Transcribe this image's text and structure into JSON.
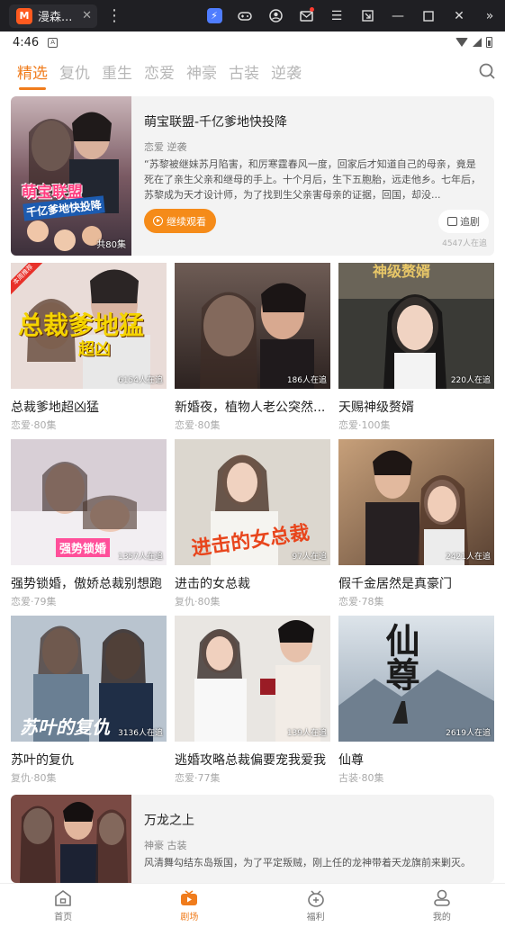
{
  "emulator": {
    "tab_title": "漫森...",
    "app_icon_glyph": "M",
    "icons": [
      "bolt-icon",
      "gamepad-icon",
      "account-icon",
      "mail-icon",
      "menu-icon",
      "screenshot-icon",
      "minimize-icon",
      "maximize-icon",
      "close-icon",
      "collapse-icon"
    ]
  },
  "status_bar": {
    "time": "4:46",
    "notif_glyph": "A"
  },
  "tabs": [
    "精选",
    "复仇",
    "重生",
    "恋爱",
    "神豪",
    "古装",
    "逆袭"
  ],
  "featured": {
    "title": "萌宝联盟-千亿爹地快投降",
    "tags": "恋爱 逆袭",
    "desc": "“苏黎被继妹苏月陷害，和厉寒霆春风一度，回家后才知道自己的母亲，竟是死在了亲生父亲和继母的手上。十个月后，生下五胞胎，远走他乡。七年后，苏黎成为天才设计师，为了找到生父亲害母亲的证据，回国，却没...",
    "continue_label": "继续观看",
    "follow_label": "追剧",
    "watching": "4547人在追",
    "poster_title_line1": "萌宝联盟",
    "poster_title_line2": "千亿爹地快投降",
    "episodes_badge": "共80集"
  },
  "grid": [
    {
      "name": "总裁爹地超凶猛",
      "meta": "恋爱·80集",
      "watching": "6154人在追",
      "cover_text": "总裁爹地猛",
      "cover_text2": "超凶",
      "ribbon": "本周推荐"
    },
    {
      "name": "新婚夜，植物人老公突然...",
      "meta": "恋爱·80集",
      "watching": "186人在追"
    },
    {
      "name": "天赐神级赘婿",
      "meta": "恋爱·100集",
      "watching": "220人在追",
      "cover_text": "神级赘婿"
    },
    {
      "name": "强势锁婚，傲娇总裁别想跑",
      "meta": "恋爱·79集",
      "watching": "1357人在追",
      "cover_text": "强势锁婚"
    },
    {
      "name": "进击的女总裁",
      "meta": "复仇·80集",
      "watching": "97人在追",
      "cover_text": "进击的女总裁"
    },
    {
      "name": "假千金居然是真豪门",
      "meta": "恋爱·78集",
      "watching": "2421人在追"
    },
    {
      "name": "苏叶的复仇",
      "meta": "复仇·80集",
      "watching": "3136人在追",
      "cover_text": "苏叶的复仇"
    },
    {
      "name": "逃婚攻略总裁偏要宠我爱我",
      "meta": "恋爱·77集",
      "watching": "139人在追"
    },
    {
      "name": "仙尊",
      "meta": "古装·80集",
      "watching": "2619人在追",
      "cover_text": "仙尊"
    }
  ],
  "featured2": {
    "title": "万龙之上",
    "tags": "神豪 古装",
    "desc": "风清舞勾结东岛叛国，为了平定叛贼，刚上任的龙神带着天龙旗前来剿灭。"
  },
  "bottom_nav": [
    {
      "label": "首页",
      "icon": "home-icon"
    },
    {
      "label": "剧场",
      "icon": "theater-icon"
    },
    {
      "label": "福利",
      "icon": "gift-icon"
    },
    {
      "label": "我的",
      "icon": "profile-icon"
    }
  ],
  "colors": {
    "accent": "#f07c1c",
    "button": "#f58b19",
    "emulator_bar": "#1f1f23"
  }
}
